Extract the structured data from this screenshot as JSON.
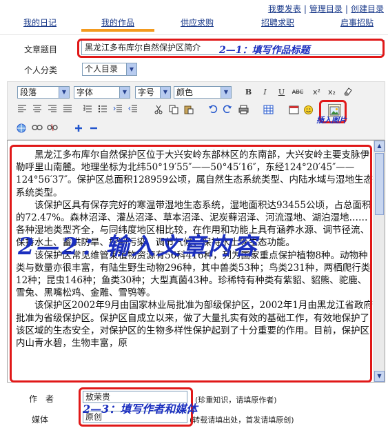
{
  "top_links": [
    "我要发表",
    "管理目录",
    "创建目录"
  ],
  "tabs": [
    {
      "label": "我的日记",
      "active": false
    },
    {
      "label": "我的作品",
      "active": true
    },
    {
      "label": "供应求购",
      "active": false
    },
    {
      "label": "招聘求职",
      "active": false
    },
    {
      "label": "启事招贴",
      "active": false
    }
  ],
  "form": {
    "title_label": "文章题目",
    "title_value": "黑龙江多布库尔自然保护区简介",
    "category_label": "个人分类",
    "category_value": "个人目录",
    "author_label": "作　者",
    "author_value": "敖荣贵",
    "author_hint": "(珍重知识，请填原作者)",
    "media_label": "媒体",
    "media_value": "原创",
    "media_hint": "(转载请填出处，首发请填原创)"
  },
  "toolbar": {
    "paragraph": "段落",
    "font": "字体",
    "size": "字号",
    "color": "颜色",
    "bold": "B",
    "italic": "I",
    "underline": "U",
    "strike": "ABC",
    "superscript": "x²",
    "subscript": "x₂"
  },
  "annotations": {
    "step1": "2—1：填写作品标题",
    "step2": "2—2：输入文章内容",
    "step3": "2—3：填写作者和媒体",
    "insert_image": "插入图片"
  },
  "article": {
    "paragraphs": [
      "黑龙江多布库尔自然保护区位于大兴安岭东部林区的东南部，大兴安岭主要支脉伊勒呼里山南麓。地理坐标为北纬50°19′55″——50°45′16″，东经124°20′45″——124°56′37″。保护区总面积128959公顷，属自然生态系统类型、内陆水域与湿地生态系统类型。",
      "该保护区具有保存完好的寒温带湿地生态系统，湿地面积达93455公顷，占总面积的72.47%。森林沼泽、灌丛沼泽、草本沼泽、泥炭藓沼泽、河流湿地、湖泊湿地……各种湿地类型齐全，与同纬度地区相比较，在作用和功能上具有涵养水源、调节径流、保持水土、蓄洪防旱、控制污染、调节气候、保持水土等生态功能。",
      "该保护区常见维管束植物资源有56科416种，列为国家重点保护植物8种。动物种类与数量亦很丰富，有陆生野生动物296种，其中兽类53种；鸟类231种，两栖爬行类12种；昆虫146种；鱼类30种；大型真菌43种。珍稀特有种类有紫貂、貂熊、驼鹿、雪兔、黑嘴松鸡、金雕、雪鸮等。",
      "该保护区2002年9月由国家林业局批准为部级保护区，2002年1月由黑龙江省政府批准为省级保护区。保护区自成立以来，做了大量扎实有效的基础工作，有效地保护了该区域的生态安全，对保护区的生物多样性保护起到了十分重要的作用。目前，保护区内山青水碧，生物丰富，原"
    ]
  },
  "colors": {
    "link": "#1a3a8a",
    "tab_active": "#f39a1e",
    "annotation_border": "#e01818",
    "annotation_text": "#1b2fbf"
  }
}
